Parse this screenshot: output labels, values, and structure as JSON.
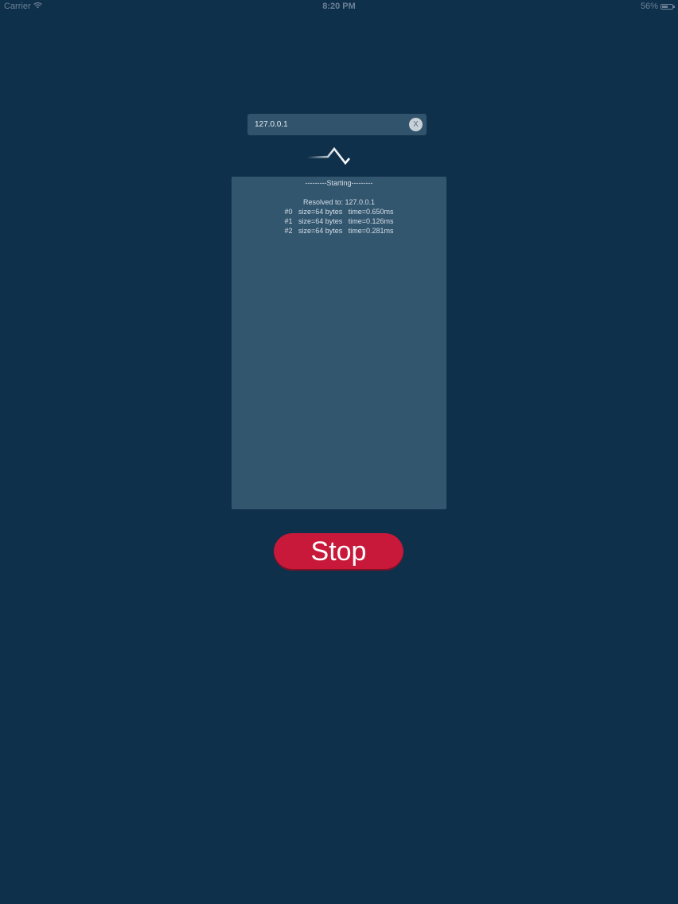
{
  "status_bar": {
    "carrier": "Carrier",
    "time": "8:20 PM",
    "battery": "56%",
    "battery_level": 0.56
  },
  "address": {
    "value": "127.0.0.1",
    "clear_glyph": "X"
  },
  "log": {
    "header": "---------Starting---------",
    "lines": [
      "Resolved to: 127.0.0.1",
      "#0   size=64 bytes   time=0.650ms",
      "#1   size=64 bytes   time=0.126ms",
      "#2   size=64 bytes   time=0.281ms"
    ]
  },
  "controls": {
    "stop_label": "Stop"
  },
  "colors": {
    "background": "#0f304b",
    "panel": "#33566f",
    "stop_button": "#c8193a"
  },
  "icons": {
    "logo": "ping-wave-icon",
    "wifi": "wifi-icon",
    "battery": "battery-icon",
    "clear": "clear-icon"
  }
}
